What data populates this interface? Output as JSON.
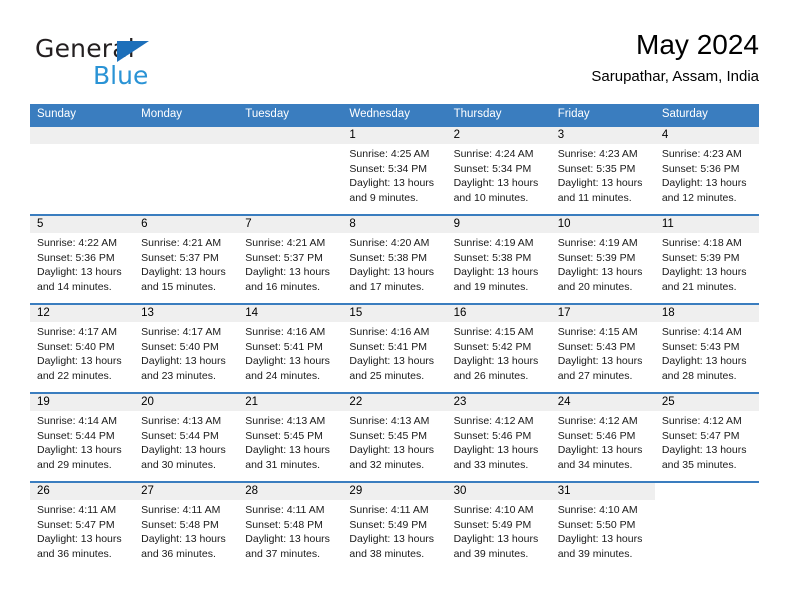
{
  "brand": {
    "line1": "General",
    "line2": "Blue",
    "triangle_color": "#1c6fba",
    "blue_color": "#2a93d5"
  },
  "header": {
    "title": "May 2024",
    "subtitle": "Sarupathar, Assam, India"
  },
  "colors": {
    "header_blue": "#3a7dbf",
    "daynum_band": "#efefef",
    "text": "#000000"
  },
  "weekdays": [
    "Sunday",
    "Monday",
    "Tuesday",
    "Wednesday",
    "Thursday",
    "Friday",
    "Saturday"
  ],
  "labels": {
    "sunrise": "Sunrise:",
    "sunset": "Sunset:",
    "daylight": "Daylight:"
  },
  "weeks": [
    [
      {
        "day": "",
        "empty": true
      },
      {
        "day": "",
        "empty": true
      },
      {
        "day": "",
        "empty": true
      },
      {
        "day": "1",
        "sunrise": "Sunrise: 4:25 AM",
        "sunset": "Sunset: 5:34 PM",
        "daylight1": "Daylight: 13 hours",
        "daylight2": "and 9 minutes."
      },
      {
        "day": "2",
        "sunrise": "Sunrise: 4:24 AM",
        "sunset": "Sunset: 5:34 PM",
        "daylight1": "Daylight: 13 hours",
        "daylight2": "and 10 minutes."
      },
      {
        "day": "3",
        "sunrise": "Sunrise: 4:23 AM",
        "sunset": "Sunset: 5:35 PM",
        "daylight1": "Daylight: 13 hours",
        "daylight2": "and 11 minutes."
      },
      {
        "day": "4",
        "sunrise": "Sunrise: 4:23 AM",
        "sunset": "Sunset: 5:36 PM",
        "daylight1": "Daylight: 13 hours",
        "daylight2": "and 12 minutes."
      }
    ],
    [
      {
        "day": "5",
        "sunrise": "Sunrise: 4:22 AM",
        "sunset": "Sunset: 5:36 PM",
        "daylight1": "Daylight: 13 hours",
        "daylight2": "and 14 minutes."
      },
      {
        "day": "6",
        "sunrise": "Sunrise: 4:21 AM",
        "sunset": "Sunset: 5:37 PM",
        "daylight1": "Daylight: 13 hours",
        "daylight2": "and 15 minutes."
      },
      {
        "day": "7",
        "sunrise": "Sunrise: 4:21 AM",
        "sunset": "Sunset: 5:37 PM",
        "daylight1": "Daylight: 13 hours",
        "daylight2": "and 16 minutes."
      },
      {
        "day": "8",
        "sunrise": "Sunrise: 4:20 AM",
        "sunset": "Sunset: 5:38 PM",
        "daylight1": "Daylight: 13 hours",
        "daylight2": "and 17 minutes."
      },
      {
        "day": "9",
        "sunrise": "Sunrise: 4:19 AM",
        "sunset": "Sunset: 5:38 PM",
        "daylight1": "Daylight: 13 hours",
        "daylight2": "and 19 minutes."
      },
      {
        "day": "10",
        "sunrise": "Sunrise: 4:19 AM",
        "sunset": "Sunset: 5:39 PM",
        "daylight1": "Daylight: 13 hours",
        "daylight2": "and 20 minutes."
      },
      {
        "day": "11",
        "sunrise": "Sunrise: 4:18 AM",
        "sunset": "Sunset: 5:39 PM",
        "daylight1": "Daylight: 13 hours",
        "daylight2": "and 21 minutes."
      }
    ],
    [
      {
        "day": "12",
        "sunrise": "Sunrise: 4:17 AM",
        "sunset": "Sunset: 5:40 PM",
        "daylight1": "Daylight: 13 hours",
        "daylight2": "and 22 minutes."
      },
      {
        "day": "13",
        "sunrise": "Sunrise: 4:17 AM",
        "sunset": "Sunset: 5:40 PM",
        "daylight1": "Daylight: 13 hours",
        "daylight2": "and 23 minutes."
      },
      {
        "day": "14",
        "sunrise": "Sunrise: 4:16 AM",
        "sunset": "Sunset: 5:41 PM",
        "daylight1": "Daylight: 13 hours",
        "daylight2": "and 24 minutes."
      },
      {
        "day": "15",
        "sunrise": "Sunrise: 4:16 AM",
        "sunset": "Sunset: 5:41 PM",
        "daylight1": "Daylight: 13 hours",
        "daylight2": "and 25 minutes."
      },
      {
        "day": "16",
        "sunrise": "Sunrise: 4:15 AM",
        "sunset": "Sunset: 5:42 PM",
        "daylight1": "Daylight: 13 hours",
        "daylight2": "and 26 minutes."
      },
      {
        "day": "17",
        "sunrise": "Sunrise: 4:15 AM",
        "sunset": "Sunset: 5:43 PM",
        "daylight1": "Daylight: 13 hours",
        "daylight2": "and 27 minutes."
      },
      {
        "day": "18",
        "sunrise": "Sunrise: 4:14 AM",
        "sunset": "Sunset: 5:43 PM",
        "daylight1": "Daylight: 13 hours",
        "daylight2": "and 28 minutes."
      }
    ],
    [
      {
        "day": "19",
        "sunrise": "Sunrise: 4:14 AM",
        "sunset": "Sunset: 5:44 PM",
        "daylight1": "Daylight: 13 hours",
        "daylight2": "and 29 minutes."
      },
      {
        "day": "20",
        "sunrise": "Sunrise: 4:13 AM",
        "sunset": "Sunset: 5:44 PM",
        "daylight1": "Daylight: 13 hours",
        "daylight2": "and 30 minutes."
      },
      {
        "day": "21",
        "sunrise": "Sunrise: 4:13 AM",
        "sunset": "Sunset: 5:45 PM",
        "daylight1": "Daylight: 13 hours",
        "daylight2": "and 31 minutes."
      },
      {
        "day": "22",
        "sunrise": "Sunrise: 4:13 AM",
        "sunset": "Sunset: 5:45 PM",
        "daylight1": "Daylight: 13 hours",
        "daylight2": "and 32 minutes."
      },
      {
        "day": "23",
        "sunrise": "Sunrise: 4:12 AM",
        "sunset": "Sunset: 5:46 PM",
        "daylight1": "Daylight: 13 hours",
        "daylight2": "and 33 minutes."
      },
      {
        "day": "24",
        "sunrise": "Sunrise: 4:12 AM",
        "sunset": "Sunset: 5:46 PM",
        "daylight1": "Daylight: 13 hours",
        "daylight2": "and 34 minutes."
      },
      {
        "day": "25",
        "sunrise": "Sunrise: 4:12 AM",
        "sunset": "Sunset: 5:47 PM",
        "daylight1": "Daylight: 13 hours",
        "daylight2": "and 35 minutes."
      }
    ],
    [
      {
        "day": "26",
        "sunrise": "Sunrise: 4:11 AM",
        "sunset": "Sunset: 5:47 PM",
        "daylight1": "Daylight: 13 hours",
        "daylight2": "and 36 minutes."
      },
      {
        "day": "27",
        "sunrise": "Sunrise: 4:11 AM",
        "sunset": "Sunset: 5:48 PM",
        "daylight1": "Daylight: 13 hours",
        "daylight2": "and 36 minutes."
      },
      {
        "day": "28",
        "sunrise": "Sunrise: 4:11 AM",
        "sunset": "Sunset: 5:48 PM",
        "daylight1": "Daylight: 13 hours",
        "daylight2": "and 37 minutes."
      },
      {
        "day": "29",
        "sunrise": "Sunrise: 4:11 AM",
        "sunset": "Sunset: 5:49 PM",
        "daylight1": "Daylight: 13 hours",
        "daylight2": "and 38 minutes."
      },
      {
        "day": "30",
        "sunrise": "Sunrise: 4:10 AM",
        "sunset": "Sunset: 5:49 PM",
        "daylight1": "Daylight: 13 hours",
        "daylight2": "and 39 minutes."
      },
      {
        "day": "31",
        "sunrise": "Sunrise: 4:10 AM",
        "sunset": "Sunset: 5:50 PM",
        "daylight1": "Daylight: 13 hours",
        "daylight2": "and 39 minutes."
      },
      {
        "day": "",
        "empty": true,
        "blank": true
      }
    ]
  ]
}
